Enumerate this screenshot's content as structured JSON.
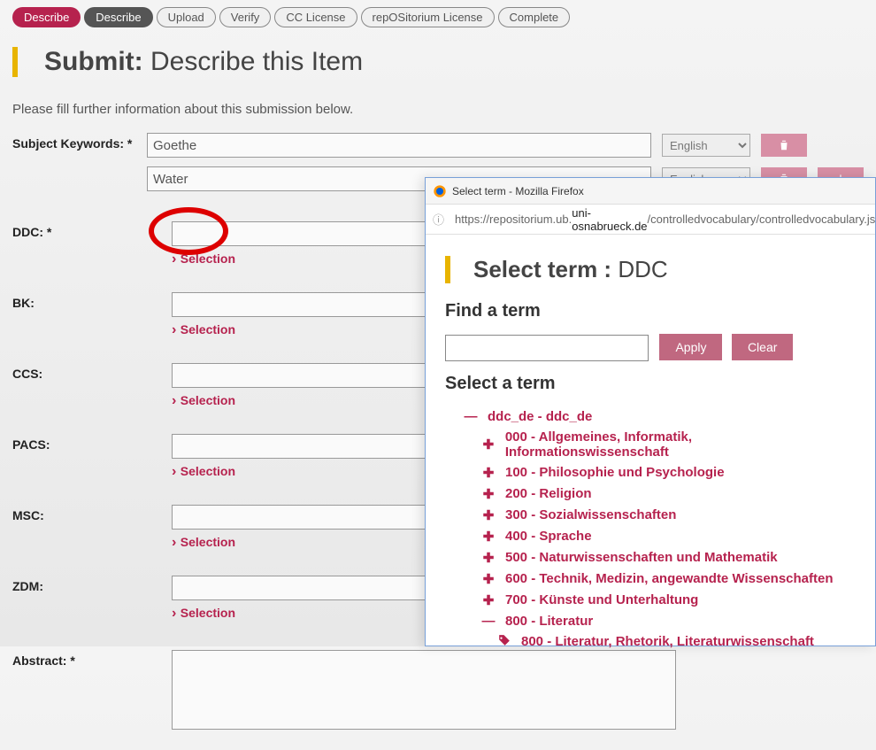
{
  "breadcrumb": [
    {
      "label": "Describe",
      "cls": "active"
    },
    {
      "label": "Describe",
      "cls": "dark"
    },
    {
      "label": "Upload",
      "cls": ""
    },
    {
      "label": "Verify",
      "cls": ""
    },
    {
      "label": "CC License",
      "cls": ""
    },
    {
      "label": "repOSitorium License",
      "cls": ""
    },
    {
      "label": "Complete",
      "cls": ""
    }
  ],
  "title": {
    "bold": "Submit:",
    "light": "Describe this Item"
  },
  "instruction": "Please fill further information about this submission below.",
  "labels": {
    "keywords": "Subject Keywords: *",
    "ddc": "DDC: *",
    "bk": "BK:",
    "ccs": "CCS:",
    "pacs": "PACS:",
    "msc": "MSC:",
    "zdm": "ZDM:",
    "abstract": "Abstract: *"
  },
  "keywords": [
    {
      "value": "Goethe",
      "lang": "English"
    },
    {
      "value": "Water",
      "lang": "English"
    }
  ],
  "selection_label": "Selection",
  "popup": {
    "window_title": "Select term - Mozilla Firefox",
    "url_prefix": "https://repositorium.ub.",
    "url_host": "uni-osnabrueck.de",
    "url_path": "/controlledvocabulary/controlledvocabulary.jsp?",
    "heading_bold": "Select term :",
    "heading_light": "DDC",
    "find_label": "Find a term",
    "apply": "Apply",
    "clear": "Clear",
    "select_label": "Select a term",
    "tree": [
      {
        "icon": "minus",
        "depth": 1,
        "label": "ddc_de - ddc_de"
      },
      {
        "icon": "plus",
        "depth": 2,
        "label": "000 - Allgemeines, Informatik, Informationswissenschaft"
      },
      {
        "icon": "plus",
        "depth": 2,
        "label": "100 - Philosophie und Psychologie"
      },
      {
        "icon": "plus",
        "depth": 2,
        "label": "200 - Religion"
      },
      {
        "icon": "plus",
        "depth": 2,
        "label": "300 - Sozialwissenschaften"
      },
      {
        "icon": "plus",
        "depth": 2,
        "label": "400 - Sprache"
      },
      {
        "icon": "plus",
        "depth": 2,
        "label": "500 - Naturwissenschaften und Mathematik"
      },
      {
        "icon": "plus",
        "depth": 2,
        "label": "600 - Technik, Medizin, angewandte Wissenschaften"
      },
      {
        "icon": "plus",
        "depth": 2,
        "label": "700 - Künste und Unterhaltung"
      },
      {
        "icon": "minus",
        "depth": 2,
        "label": "800 - Literatur"
      },
      {
        "icon": "tag",
        "depth": 3,
        "label": "800 - Literatur, Rhetorik, Literaturwissenschaft"
      }
    ]
  }
}
